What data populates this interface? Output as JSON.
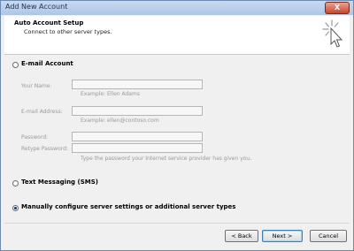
{
  "window": {
    "title": "Add New Account",
    "close_label": "X"
  },
  "header": {
    "title": "Auto Account Setup",
    "subtitle": "Connect to other server types."
  },
  "options": {
    "email_account": {
      "label": "E-mail Account",
      "checked": false
    },
    "text_messaging": {
      "label": "Text Messaging (SMS)",
      "checked": false
    },
    "manual_config": {
      "label": "Manually configure server settings or additional server types",
      "checked": true
    }
  },
  "fields": {
    "your_name": {
      "label": "Your Name:",
      "hint": "Example: Ellen Adams"
    },
    "email_address": {
      "label": "E-mail Address:",
      "hint": "Example: ellen@contoso.com"
    },
    "password": {
      "label": "Password:"
    },
    "retype_password": {
      "label": "Retype Password:",
      "hint": "Type the password your Internet service provider has given you."
    }
  },
  "buttons": {
    "back": "< Back",
    "next": "Next >",
    "cancel": "Cancel"
  },
  "icons": {
    "wizard": "wizard-cursor-icon"
  }
}
